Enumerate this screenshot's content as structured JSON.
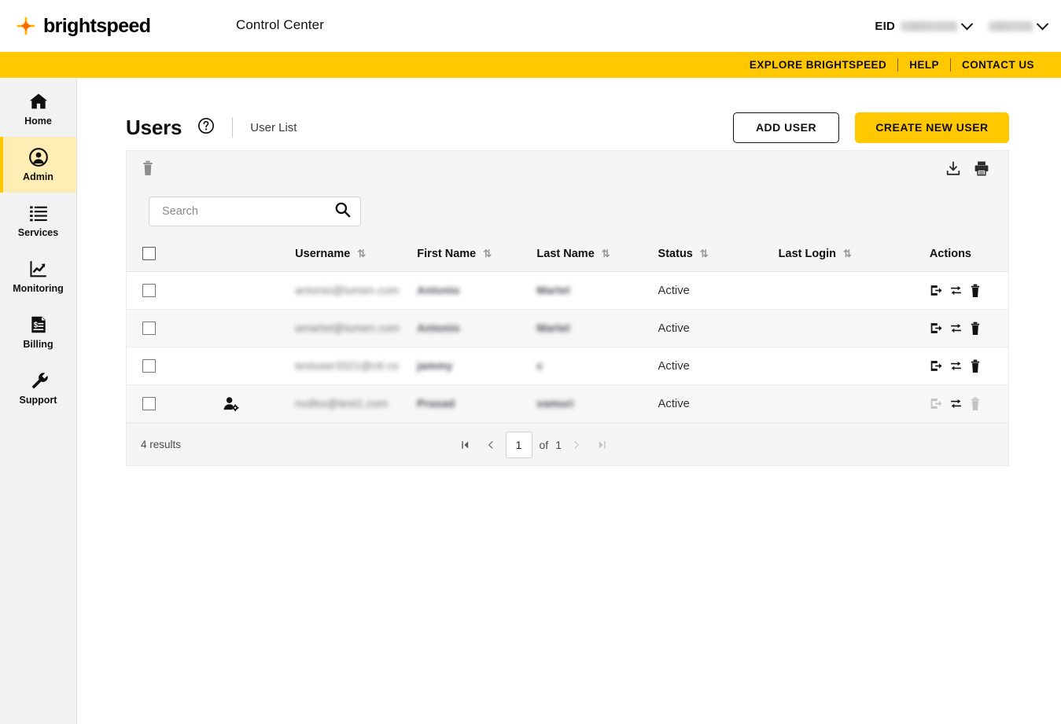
{
  "header": {
    "brand_name": "brightspeed",
    "brand_logo_icon": "sparkle-star-icon",
    "app_title": "Control Center",
    "eid_label": "EID",
    "eid_value_redacted": "••••••••",
    "account_value_redacted": "••••••",
    "chevron_icon": "chevron-down-icon"
  },
  "utilbar": {
    "links": [
      {
        "label": "EXPLORE BRIGHTSPEED"
      },
      {
        "label": "HELP"
      },
      {
        "label": "CONTACT US"
      }
    ],
    "background": "#ffc800"
  },
  "sidebar": {
    "items": [
      {
        "label": "Home",
        "icon": "home-icon",
        "active": false
      },
      {
        "label": "Admin",
        "icon": "user-circle-icon",
        "active": true
      },
      {
        "label": "Services",
        "icon": "list-icon",
        "active": false
      },
      {
        "label": "Monitoring",
        "icon": "chart-trend-icon",
        "active": false
      },
      {
        "label": "Billing",
        "icon": "invoice-dollar-icon",
        "active": false
      },
      {
        "label": "Support",
        "icon": "wrench-icon",
        "active": false
      }
    ],
    "active_background": "#ffeeb3",
    "active_accent": "#ffc800"
  },
  "page": {
    "title": "Users",
    "help_icon": "question-circle-icon",
    "breadcrumb": "User List",
    "buttons": {
      "add_user": "ADD USER",
      "create_new_user": "CREATE NEW USER"
    }
  },
  "toolbar": {
    "delete_icon": "trash-icon",
    "download_icon": "download-icon",
    "print_icon": "print-icon"
  },
  "search": {
    "placeholder": "Search",
    "value": "",
    "icon": "search-icon"
  },
  "table": {
    "columns": [
      {
        "label": "",
        "sortable": false,
        "key": "checkbox"
      },
      {
        "label": "",
        "sortable": false,
        "key": "badge"
      },
      {
        "label": "Username",
        "sortable": true,
        "key": "username"
      },
      {
        "label": "First Name",
        "sortable": true,
        "key": "first_name"
      },
      {
        "label": "Last Name",
        "sortable": true,
        "key": "last_name"
      },
      {
        "label": "Status",
        "sortable": true,
        "key": "status"
      },
      {
        "label": "Last Login",
        "sortable": true,
        "key": "last_login"
      },
      {
        "label": "Actions",
        "sortable": false,
        "key": "actions"
      }
    ],
    "sort_icon": "⇅",
    "rows": [
      {
        "badge_icon": "",
        "username": "antonio@lumen.com",
        "first_name": "Antonio",
        "last_name": "Martel",
        "status": "Active",
        "last_login": "",
        "actions_enabled": true
      },
      {
        "badge_icon": "",
        "username": "amartel@lumen.com",
        "first_name": "Antonio",
        "last_name": "Martel",
        "status": "Active",
        "last_login": "",
        "actions_enabled": true
      },
      {
        "badge_icon": "",
        "username": "testuser3321@ctl.co",
        "first_name": "jammy",
        "last_name": "c",
        "status": "Active",
        "last_login": "",
        "actions_enabled": true
      },
      {
        "badge_icon": "user-gear-icon",
        "username": "nvdlss@test1.com",
        "first_name": "Prasad",
        "last_name": "vamuri",
        "status": "Active",
        "last_login": "",
        "actions_enabled": false
      }
    ],
    "row_actions": {
      "impersonate_icon": "export-arrow-icon",
      "transfer_icon": "swap-arrows-icon",
      "delete_icon": "trash-icon"
    }
  },
  "footer": {
    "results_text": "4 results",
    "first_icon": "first-page-icon",
    "prev_icon": "prev-page-icon",
    "current_page": "1",
    "of_label": "of",
    "total_pages": "1",
    "next_icon": "next-page-icon",
    "last_icon": "last-page-icon"
  }
}
